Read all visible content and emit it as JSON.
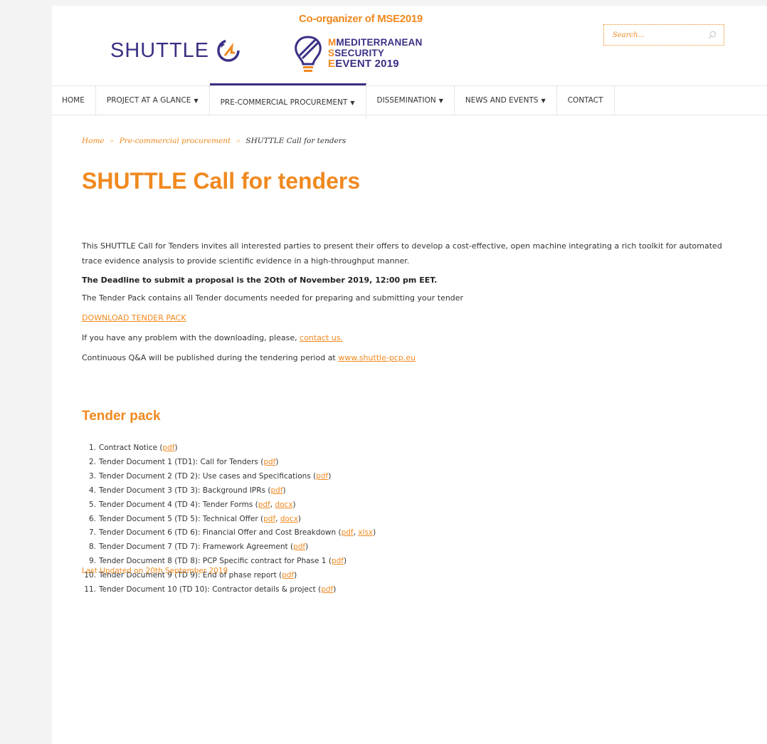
{
  "header": {
    "logo_text": "SHUTTLE",
    "coorganizer": "Co-organizer of MSE2019",
    "mse_line1": "MEDITERRANEAN",
    "mse_line2": "SECURITY",
    "mse_line3": "EVENT",
    "mse_year": "2019",
    "search_placeholder": "Search..."
  },
  "nav": [
    {
      "label": "HOME",
      "dropdown": false
    },
    {
      "label": "PROJECT AT A GLANCE",
      "dropdown": true
    },
    {
      "label": "PRE-COMMERCIAL PROCUREMENT",
      "dropdown": true,
      "active": true
    },
    {
      "label": "DISSEMINATION",
      "dropdown": true
    },
    {
      "label": "NEWS AND EVENTS",
      "dropdown": true
    },
    {
      "label": "CONTACT",
      "dropdown": false
    }
  ],
  "breadcrumb": {
    "home": "Home",
    "sep": "»",
    "section": "Pre-commercial procurement",
    "current": "SHUTTLE Call for tenders"
  },
  "title": "SHUTTLE Call for tenders",
  "intro": "This SHUTTLE Call  for Tenders invites all interested parties to present their offers to develop a cost-effective, open machine integrating a rich toolkit for automated trace evidence analysis to provide scientific evidence in a high-throughput manner.",
  "deadline": "The Deadline to submit a proposal is the 2Oth of November 2019, 12:00 pm EET.",
  "tender_pack_text": "The Tender Pack contains all Tender documents needed for preparing and submitting your tender",
  "download_link": "DOWNLOAD TENDER PACK",
  "problem_text": "If you have any problem with the downloading, please, ",
  "contact_link": "contact us.",
  "qa_text": "Continuous Q&A will be published during the tendering period at ",
  "qa_link": "www.shuttle-pcp.eu",
  "tender_pack_heading": "Tender pack",
  "tender_items": [
    {
      "num": "1.",
      "text": "Contract Notice (",
      "links": [
        "pdf"
      ]
    },
    {
      "num": "2.",
      "text": "Tender Document 1 (TD1): Call for Tenders (",
      "links": [
        "pdf"
      ]
    },
    {
      "num": "3.",
      "text": "Tender Document 2 (TD 2): Use cases and Specifications (",
      "links": [
        "pdf"
      ]
    },
    {
      "num": "4.",
      "text": "Tender Document 3 (TD 3): Background IPRs (",
      "links": [
        "pdf"
      ]
    },
    {
      "num": "5.",
      "text": "Tender Document 4 (TD 4): Tender Forms (",
      "links": [
        "pdf",
        "docx"
      ]
    },
    {
      "num": "6.",
      "text": "Tender Document 5 (TD 5): Technical Offer (",
      "links": [
        "pdf",
        "docx"
      ]
    },
    {
      "num": "7.",
      "text": "Tender Document 6 (TD 6): Financial Offer and Cost Breakdown (",
      "links": [
        "pdf",
        "xlsx"
      ]
    },
    {
      "num": "8.",
      "text": "Tender Document 7 (TD 7): Framework Agreement (",
      "links": [
        "pdf"
      ]
    },
    {
      "num": "9.",
      "text": "Tender Document 8 (TD 8): PCP Specific contract for Phase 1 (",
      "links": [
        "pdf"
      ]
    },
    {
      "num": "10.",
      "text": "Tender Document 9 (TD 9): End of phase report (",
      "links": [
        "pdf"
      ]
    },
    {
      "num": "11.",
      "text": "Tender Document 10 (TD 10): Contractor details & project (",
      "links": [
        "pdf"
      ]
    }
  ],
  "last_updated": "Last Updated on 20th September 2019",
  "colors": {
    "accent": "#f0891f",
    "brand": "#3a3185"
  },
  "icons": {
    "search": "search-icon",
    "shuttle_logo": "shuttle-logo-icon",
    "mse_logo": "mse-logo-icon"
  }
}
